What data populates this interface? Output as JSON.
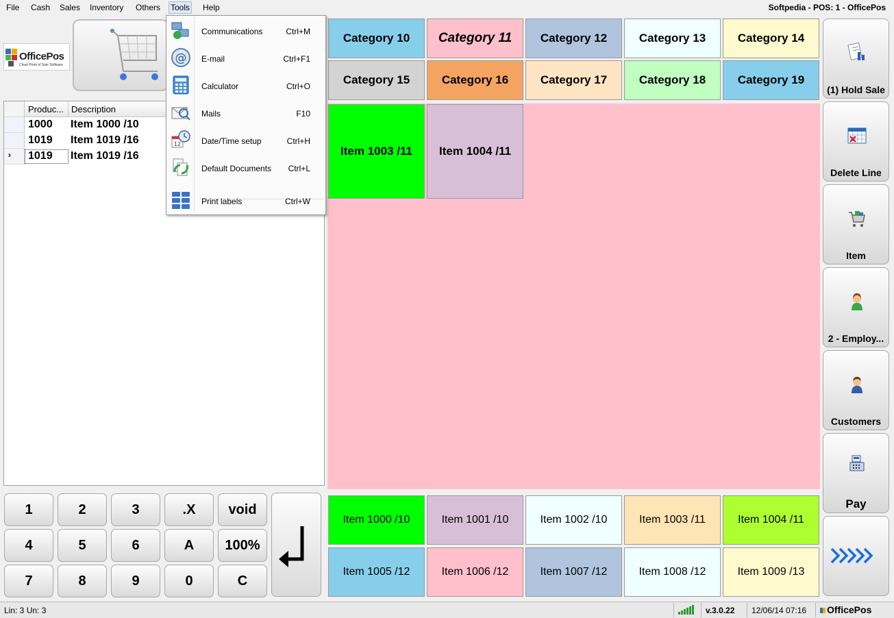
{
  "menu": {
    "items": [
      "File",
      "Cash",
      "Sales",
      "Inventory",
      "Others",
      "Tools",
      "Help"
    ],
    "title": "Softpedia - POS: 1 - OfficePos"
  },
  "logo": {
    "name": "OfficePos",
    "tagline": "Cloud Point of Sale Software"
  },
  "grid": {
    "headers": {
      "product": "Produc...",
      "description": "Description"
    },
    "rows": [
      {
        "product": "1000",
        "description": "Item 1000 /10"
      },
      {
        "product": "1019",
        "description": "Item 1019 /16"
      },
      {
        "product": "1019",
        "description": "Item 1019 /16"
      }
    ],
    "current_row_marker": "›"
  },
  "tools_menu": [
    {
      "label": "Communications",
      "shortcut": "Ctrl+M",
      "icon": "communications-icon"
    },
    {
      "label": "E-mail",
      "shortcut": "Ctrl+F1",
      "icon": "email-icon"
    },
    {
      "label": "Calculator",
      "shortcut": "Ctrl+O",
      "icon": "calculator-icon"
    },
    {
      "label": "Mails",
      "shortcut": "F10",
      "icon": "mails-icon"
    },
    {
      "label": "Date/Time setup",
      "shortcut": "Ctrl+H",
      "icon": "calendar-clock-icon"
    },
    {
      "label": "Default Documents",
      "shortcut": "Ctrl+L",
      "icon": "documents-icon"
    },
    {
      "label": "Print labels",
      "shortcut": "Ctrl+W",
      "icon": "labels-icon"
    }
  ],
  "categories": [
    {
      "label": "Category 10",
      "color": "#87ceeb"
    },
    {
      "label": "Category 11",
      "color": "#ffc0cb",
      "italic": true
    },
    {
      "label": "Category 12",
      "color": "#b0c4de"
    },
    {
      "label": "Category 13",
      "color": "#f0ffff"
    },
    {
      "label": "Category 14",
      "color": "#fffacd"
    },
    {
      "label": "Category 15",
      "color": "#d3d3d3"
    },
    {
      "label": "Category 16",
      "color": "#f4a460"
    },
    {
      "label": "Category 17",
      "color": "#ffe4c4"
    },
    {
      "label": "Category 18",
      "color": "#c1ffc1"
    },
    {
      "label": "Category 19",
      "color": "#87ceeb"
    }
  ],
  "category_items": [
    {
      "label": "Item 1003 /11",
      "color": "#00ff00"
    },
    {
      "label": "Item 1004 /11",
      "color": "#d8bfd8"
    }
  ],
  "quick_items": [
    {
      "label": "Item 1000 /10",
      "color": "#00ff00"
    },
    {
      "label": "Item 1001 /10",
      "color": "#d8bfd8"
    },
    {
      "label": "Item 1002 /10",
      "color": "#f0ffff"
    },
    {
      "label": "Item 1003 /11",
      "color": "#ffe4b5"
    },
    {
      "label": "Item 1004 /11",
      "color": "#adff2f"
    },
    {
      "label": "Item 1005 /12",
      "color": "#87ceeb"
    },
    {
      "label": "Item 1006 /12",
      "color": "#ffc0cb"
    },
    {
      "label": "Item 1007 /12",
      "color": "#b0c4de"
    },
    {
      "label": "Item 1008 /12",
      "color": "#f0ffff"
    },
    {
      "label": "Item 1009 /13",
      "color": "#fffacd"
    }
  ],
  "keypad": [
    "1",
    "2",
    "3",
    ".X",
    "void",
    "4",
    "5",
    "6",
    "A",
    "100%",
    "7",
    "8",
    "9",
    "0",
    "C"
  ],
  "side_buttons": [
    {
      "label": "(1) Hold Sale",
      "icon": "hold-sale-icon"
    },
    {
      "label": "Delete Line",
      "icon": "delete-line-icon"
    },
    {
      "label": "Item",
      "icon": "item-cart-icon"
    },
    {
      "label": "2 - Employ...",
      "icon": "employee-icon"
    },
    {
      "label": "Customers",
      "icon": "customer-icon"
    },
    {
      "label": "Pay",
      "icon": "pay-register-icon"
    }
  ],
  "more_button_icon": "chevrons-right-icon",
  "status": {
    "lines": "Lin: 3  Un: 3",
    "version": "v.3.0.22",
    "datetime": "12/06/14 07:16",
    "brand": "OfficePos"
  }
}
